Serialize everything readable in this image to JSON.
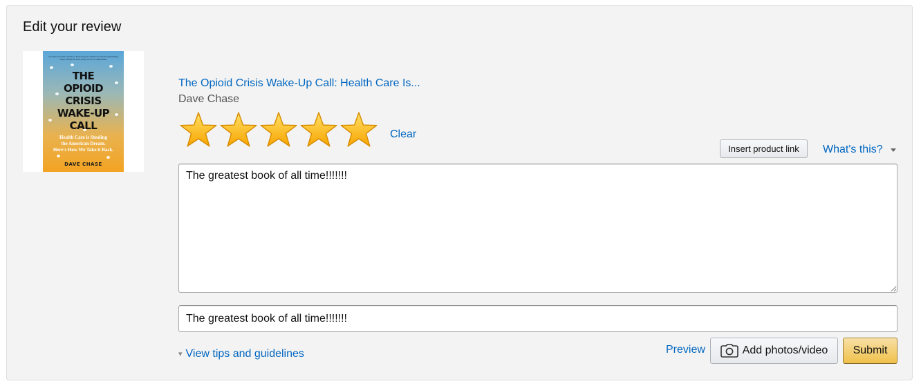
{
  "page": {
    "title": "Edit your review"
  },
  "product": {
    "title": "The Opioid Crisis Wake-Up Call: Health Care Is...",
    "author": "Dave Chase",
    "cover": {
      "blurb": "A Citizen Leader's Guide to Restoring the American Dream, Rebuilding Hope, Health & Well-being in Our Communities",
      "title_lines": [
        "THE",
        "OPIOID",
        "CRISIS",
        "WAKE-UP",
        "CALL"
      ],
      "subtitle_lines": [
        "Health Care is Stealing",
        "the American Dream.",
        "Here's How We Take it Back."
      ],
      "author": "DAVE CHASE"
    }
  },
  "rating": {
    "value": 5,
    "max": 5,
    "clear_label": "Clear",
    "star_color": "#ffc400"
  },
  "toolbar": {
    "insert_product_link": "Insert product link",
    "whats_this": "What's this?"
  },
  "review": {
    "body": "The greatest book of all time!!!!!!!",
    "headline": "The greatest book of all time!!!!!!!"
  },
  "footer": {
    "tips_label": "View tips and guidelines",
    "preview_label": "Preview",
    "add_photos_label": "Add photos/video",
    "submit_label": "Submit"
  },
  "colors": {
    "link": "#0066c0",
    "panel_bg": "#f3f3f3",
    "submit_bg": "#f0c14b"
  },
  "icons": {
    "star": "star-icon",
    "caret": "caret-down-icon",
    "tips": "double-chevron-down-icon",
    "camera": "camera-icon"
  }
}
